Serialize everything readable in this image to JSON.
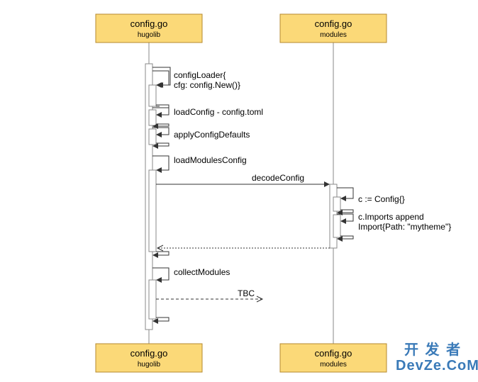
{
  "participants": {
    "left": {
      "title": "config.go",
      "subtitle": "hugolib"
    },
    "right": {
      "title": "config.go",
      "subtitle": "modules"
    }
  },
  "messages": {
    "m1a": "configLoader{",
    "m1b": "cfg: config.New()}",
    "m2": "loadConfig - config.toml",
    "m3": "applyConfigDefaults",
    "m4": "loadModulesConfig",
    "m5": "decodeConfig",
    "m6": "c := Config{}",
    "m7a": "c.Imports append",
    "m7b": "Import{Path: \"mytheme\"}",
    "m8": "collectModules",
    "m9": "TBC"
  },
  "watermark": {
    "line1": "开 发 者",
    "line2": "DevZe.CoM"
  }
}
